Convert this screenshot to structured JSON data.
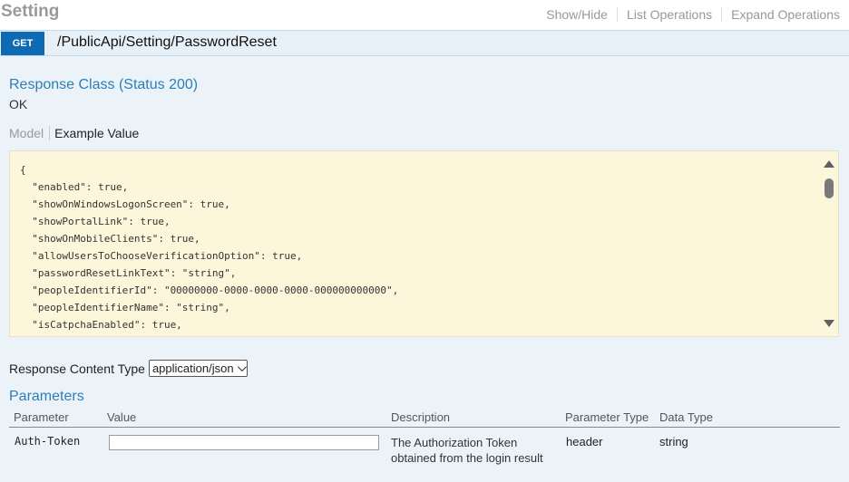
{
  "header": {
    "section_title": "Setting",
    "links": [
      "Show/Hide",
      "List Operations",
      "Expand Operations"
    ]
  },
  "operation": {
    "method": "GET",
    "path": "/PublicApi/Setting/PasswordReset"
  },
  "response": {
    "class_label": "Response Class (Status 200)",
    "status_text": "OK",
    "tabs": {
      "model": "Model",
      "example": "Example Value"
    },
    "example_lines": [
      "{",
      "  \"enabled\": true,",
      "  \"showOnWindowsLogonScreen\": true,",
      "  \"showPortalLink\": true,",
      "  \"showOnMobileClients\": true,",
      "  \"allowUsersToChooseVerificationOption\": true,",
      "  \"passwordResetLinkText\": \"string\",",
      "  \"peopleIdentifierId\": \"00000000-0000-0000-0000-000000000000\",",
      "  \"peopleIdentifierName\": \"string\",",
      "  \"isCatpchaEnabled\": true,"
    ]
  },
  "content_type": {
    "label": "Response Content Type",
    "selected": "application/json"
  },
  "parameters": {
    "title": "Parameters",
    "columns": [
      "Parameter",
      "Value",
      "Description",
      "Parameter Type",
      "Data Type"
    ],
    "rows": [
      {
        "name": "Auth-Token",
        "value": "",
        "description": "The Authorization Token obtained from the login result",
        "param_type": "header",
        "data_type": "string"
      }
    ]
  }
}
